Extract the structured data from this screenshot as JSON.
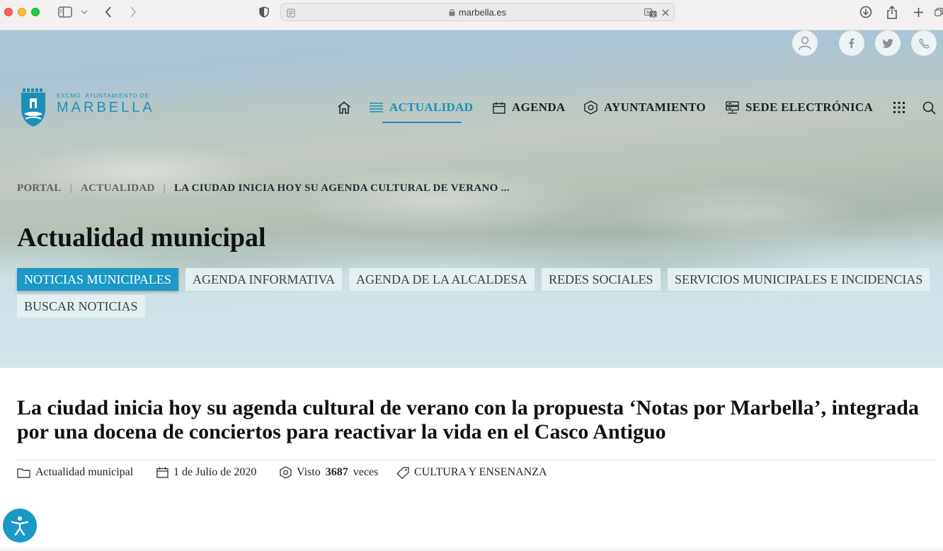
{
  "browser": {
    "url": "marbella.es"
  },
  "logo": {
    "small_text": "EXCMO. AYUNTAMIENTO DE",
    "big_text": "MARBELLA"
  },
  "nav": {
    "items": [
      {
        "label": "ACTUALIDAD",
        "icon": "menu-lines-icon"
      },
      {
        "label": "AGENDA",
        "icon": "calendar-icon"
      },
      {
        "label": "AYUNTAMIENTO",
        "icon": "hexagon-icon"
      },
      {
        "label": "SEDE ELECTRÓNICA",
        "icon": "server-icon"
      }
    ],
    "active_color": "#1a8fb7"
  },
  "breadcrumb": {
    "items": [
      "PORTAL",
      "ACTUALIDAD",
      "LA CIUDAD INICIA HOY SU AGENDA CULTURAL DE VERANO ..."
    ],
    "separator": "|"
  },
  "section": {
    "title": "Actualidad municipal"
  },
  "tabs": [
    {
      "label": "NOTICIAS MUNICIPALES",
      "active": true
    },
    {
      "label": "AGENDA INFORMATIVA",
      "active": false
    },
    {
      "label": "AGENDA DE LA ALCALDESA",
      "active": false
    },
    {
      "label": "REDES SOCIALES",
      "active": false
    },
    {
      "label": "SERVICIOS MUNICIPALES E INCIDENCIAS",
      "active": false
    },
    {
      "label": "BUSCAR NOTICIAS",
      "active": false
    }
  ],
  "article": {
    "title": "La ciudad inicia hoy su agenda cultural de verano con la propuesta ‘Notas por Marbella’, integrada por una docena de conciertos para reactivar la vida en el Casco Antiguo",
    "category": "Actualidad municipal",
    "date": "1 de Julio de 2020",
    "views_prefix": "Visto",
    "views_count": "3687",
    "views_suffix": "veces",
    "tag": "CULTURA Y ENSENANZA"
  },
  "colors": {
    "accent": "#1a98c6",
    "tab_bg": "#e4eff2"
  }
}
